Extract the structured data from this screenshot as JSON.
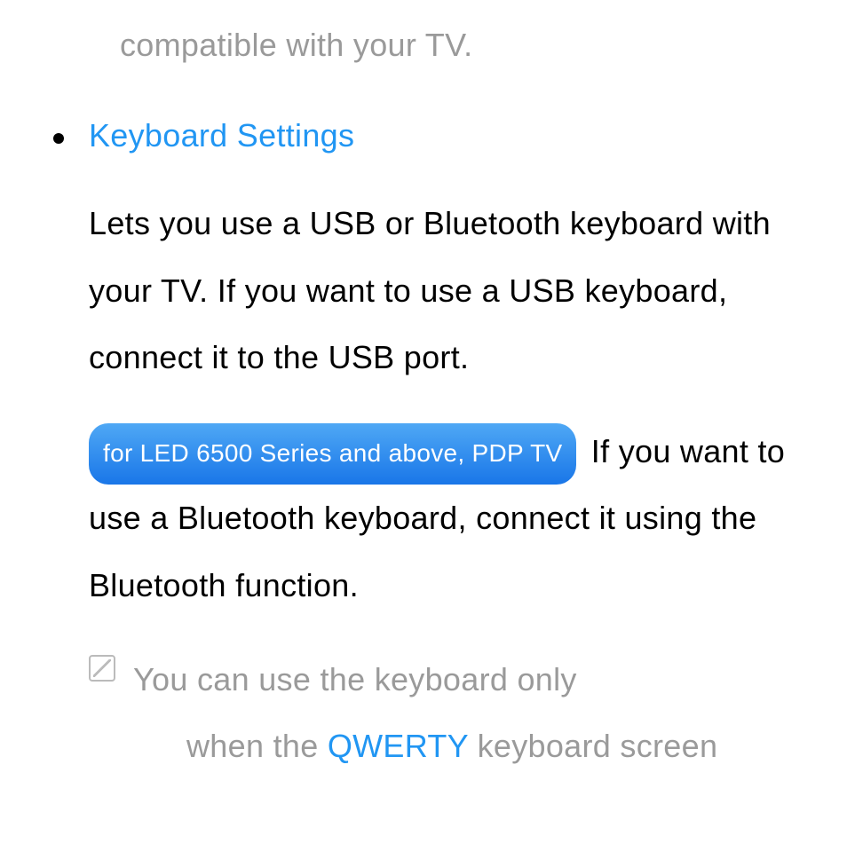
{
  "fragmentTop": "compatible with your TV.",
  "heading": "Keyboard Settings",
  "paragraph1": "Lets you use a USB or Bluetooth keyboard with your TV. If you want to use a USB keyboard, connect it to the USB port.",
  "pillLabel": "for LED 6500 Series and above, PDP TV",
  "paragraph2": " If you want to use a Bluetooth keyboard, connect it using the Bluetooth function.",
  "noteLine1": "You can use the keyboard only",
  "noteLine2Prefix": "when the ",
  "noteLine2Highlight": "QWERTY",
  "noteLine2Suffix": " keyboard screen"
}
